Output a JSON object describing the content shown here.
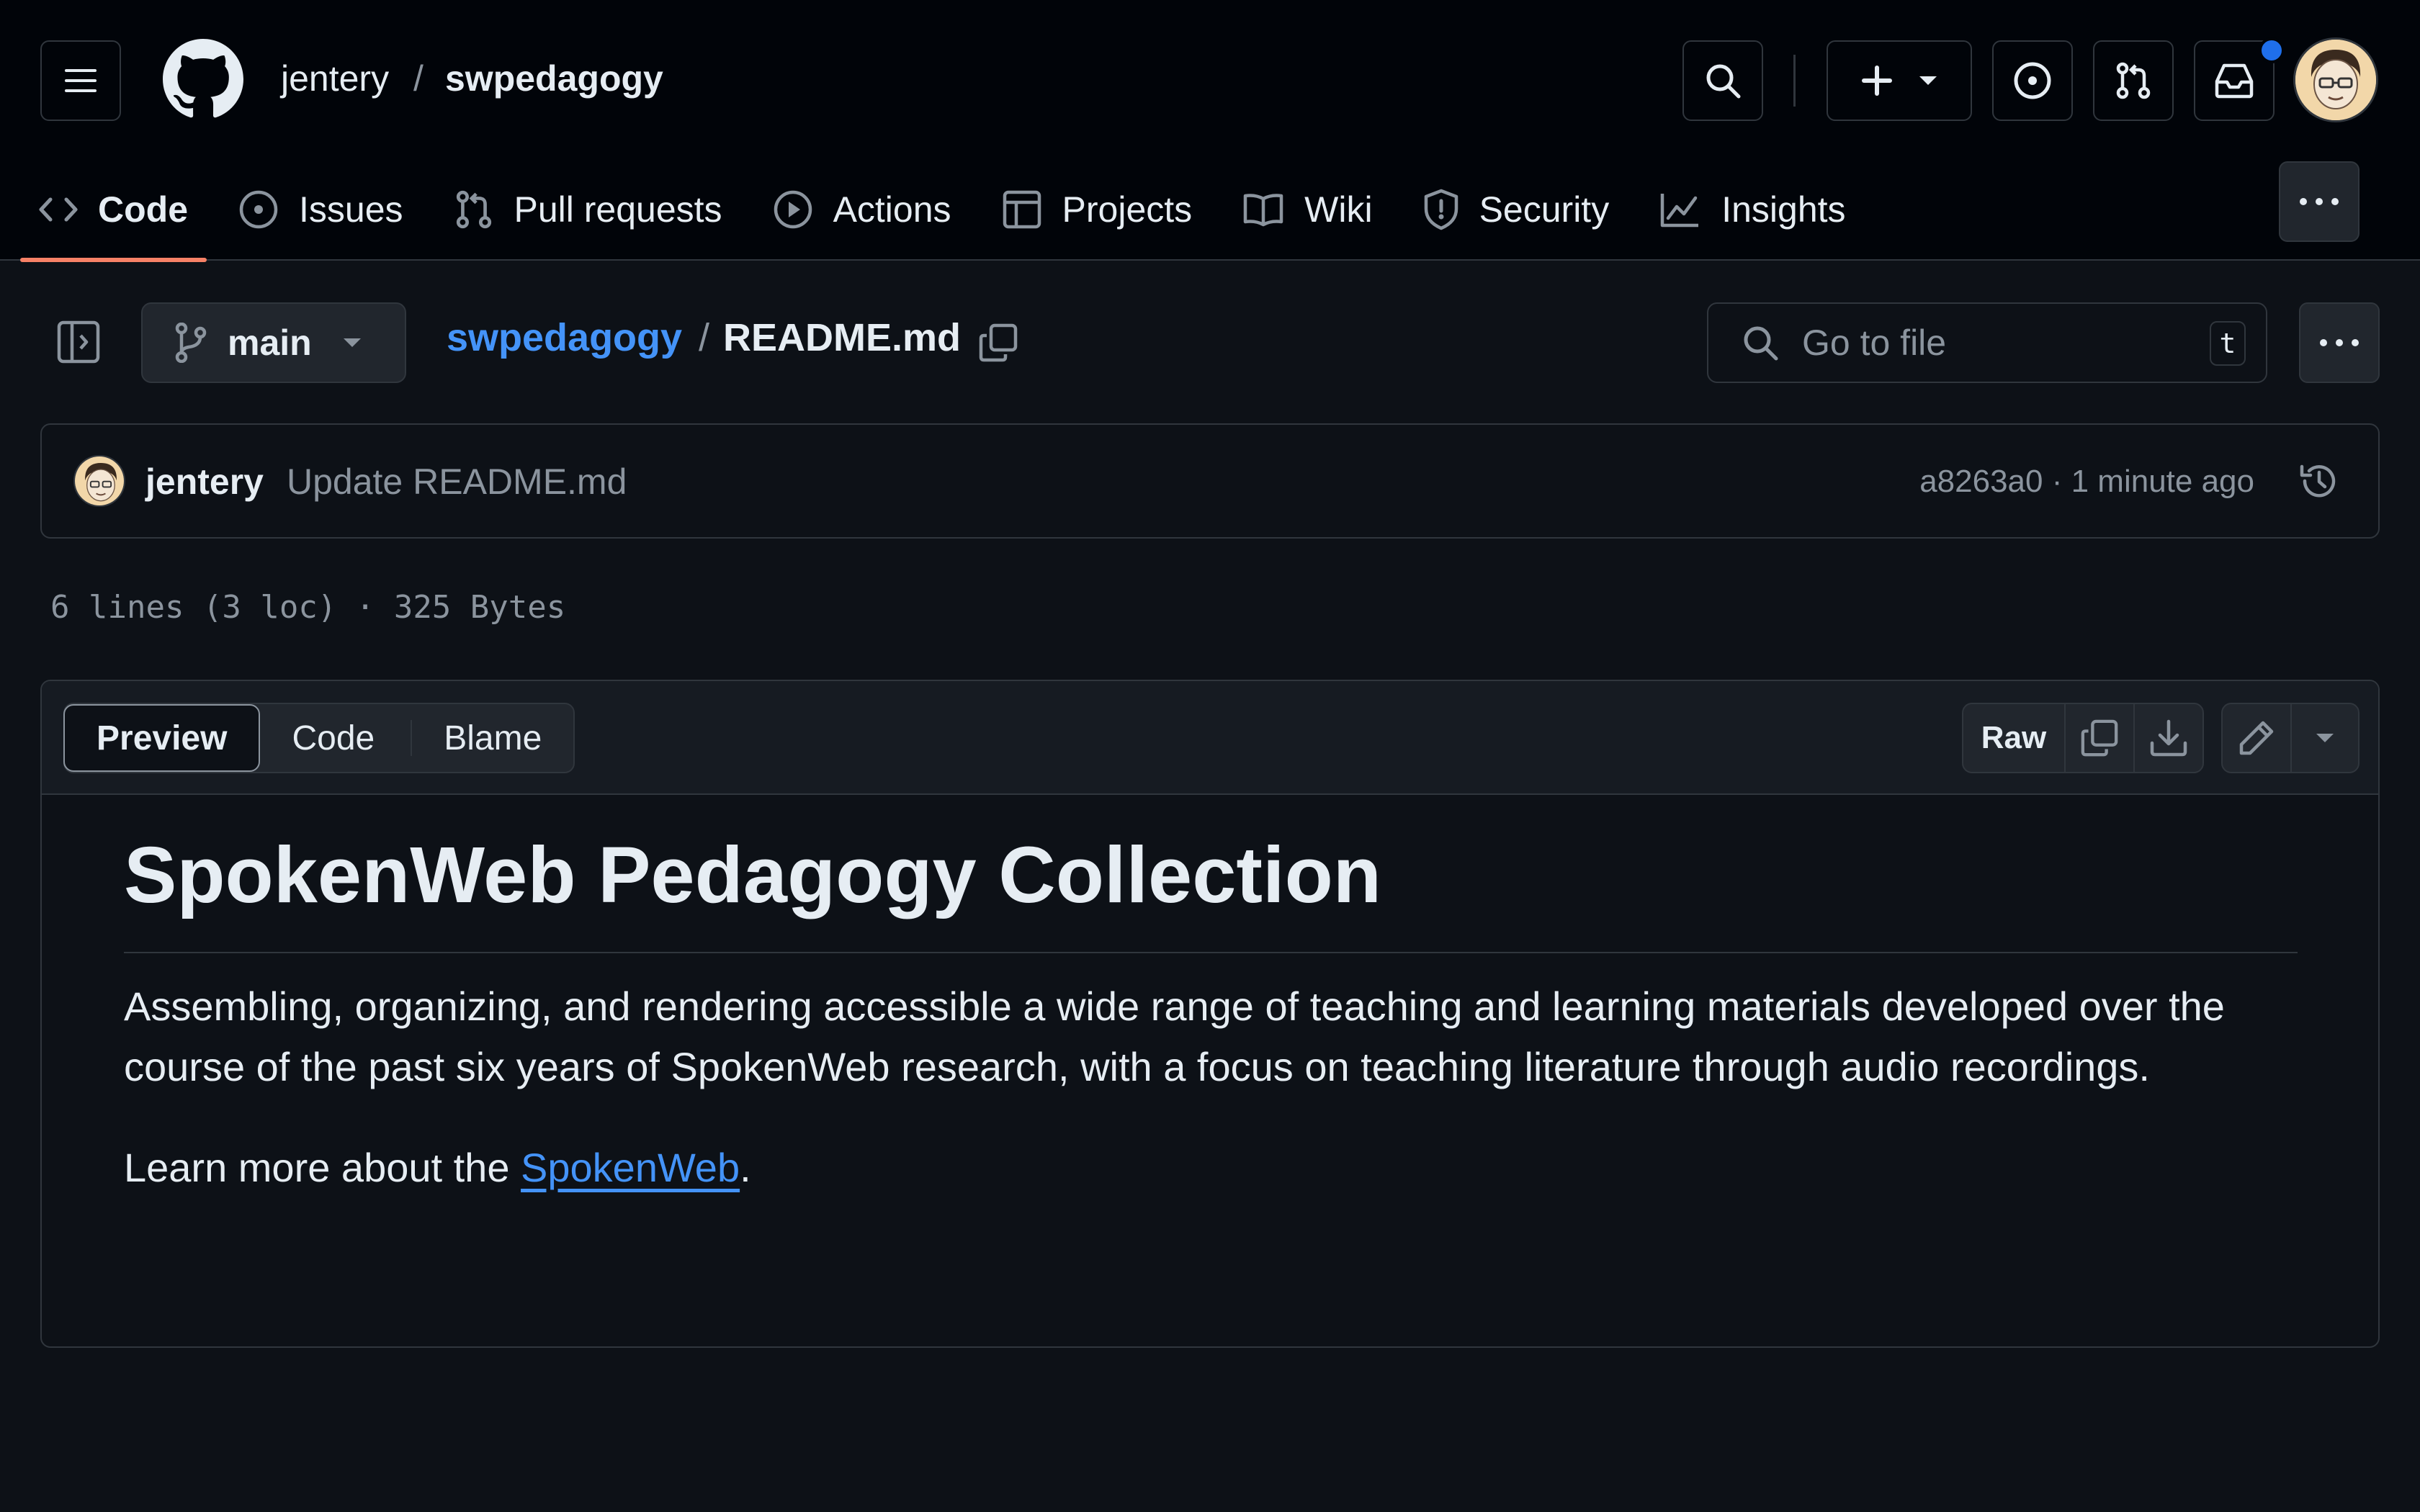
{
  "header": {
    "owner": "jentery",
    "separator": "/",
    "repo": "swpedagogy"
  },
  "nav_tabs": [
    {
      "label": "Code",
      "icon": "code-icon",
      "active": true
    },
    {
      "label": "Issues",
      "icon": "issue-icon"
    },
    {
      "label": "Pull requests",
      "icon": "pull-request-icon"
    },
    {
      "label": "Actions",
      "icon": "play-icon"
    },
    {
      "label": "Projects",
      "icon": "table-icon"
    },
    {
      "label": "Wiki",
      "icon": "book-icon"
    },
    {
      "label": "Security",
      "icon": "shield-icon"
    },
    {
      "label": "Insights",
      "icon": "graph-icon"
    }
  ],
  "file_nav": {
    "branch": "main",
    "repo_link": "swpedagogy",
    "path_sep": "/",
    "filename": "README.md",
    "search_placeholder": "Go to file",
    "search_shortcut": "t"
  },
  "commit": {
    "author": "jentery",
    "message": "Update README.md",
    "sha_time": "a8263a0 · 1 minute ago"
  },
  "file_meta": "6 lines (3 loc) · 325 Bytes",
  "viewer": {
    "modes": [
      "Preview",
      "Code",
      "Blame"
    ],
    "selected_mode": "Preview",
    "raw_label": "Raw"
  },
  "readme": {
    "title": "SpokenWeb Pedagogy Collection",
    "paragraph": "Assembling, organizing, and rendering accessible a wide range of teaching and learning materials developed over the course of the past six years of SpokenWeb research, with a focus on teaching literature through audio recordings.",
    "learn_prefix": "Learn more about the ",
    "learn_link": "SpokenWeb",
    "learn_suffix": "."
  },
  "colors": {
    "background": "#0d1117",
    "topbar": "#010409",
    "border": "#30363d",
    "link": "#4493f8",
    "active_tab_underline": "#f78166",
    "notification_dot": "#1f6feb"
  }
}
